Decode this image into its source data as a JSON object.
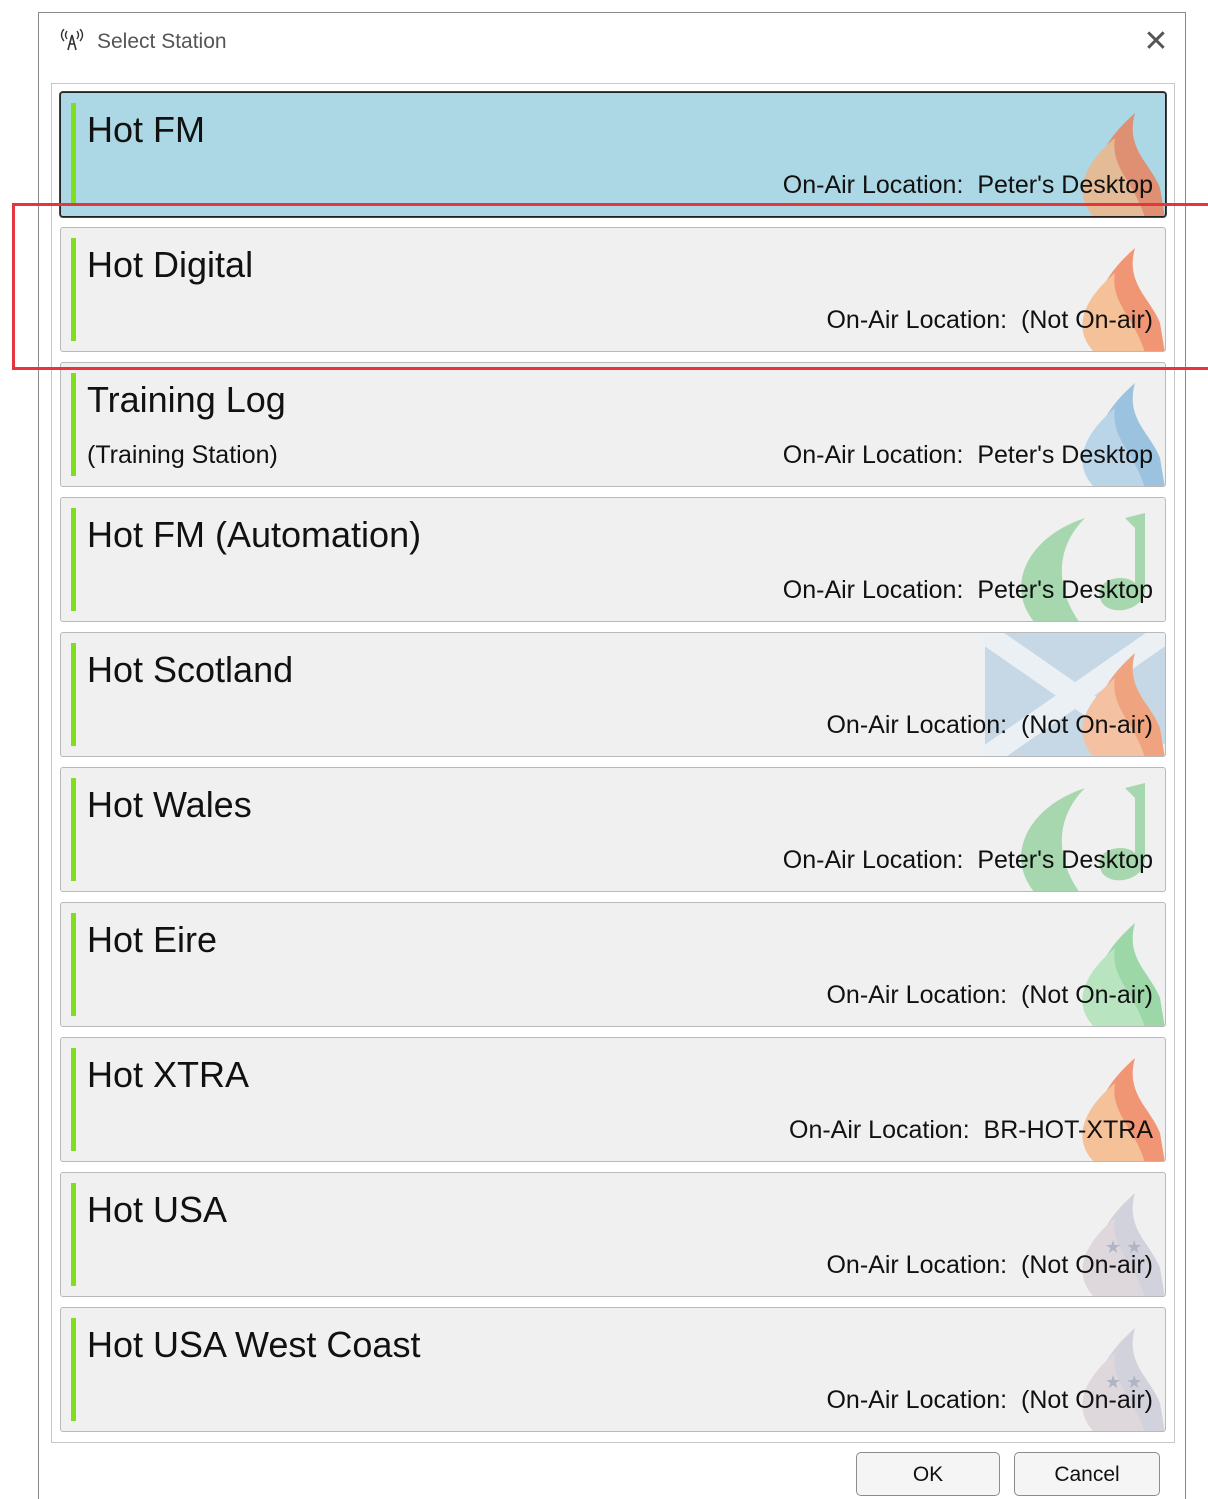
{
  "window": {
    "title": "Select Station",
    "icon": "antenna-icon",
    "close_symbol": "✕"
  },
  "stations": [
    {
      "name": "Hot FM",
      "sub": "",
      "location_label": "On-Air Location:",
      "location_value": "Peter's Desktop",
      "selected": true,
      "logo": "flame-logo"
    },
    {
      "name": "Hot Digital",
      "sub": "",
      "location_label": "On-Air Location:",
      "location_value": "(Not On-air)",
      "selected": false,
      "logo": "flame-logo"
    },
    {
      "name": "Training Log",
      "sub": "(Training Station)",
      "location_label": "On-Air Location:",
      "location_value": "Peter's Desktop",
      "selected": false,
      "logo": "flame-logo-blue"
    },
    {
      "name": "Hot FM (Automation)",
      "sub": "",
      "location_label": "On-Air Location:",
      "location_value": "Peter's Desktop",
      "selected": false,
      "logo": "swoosh-logo-green"
    },
    {
      "name": "Hot Scotland",
      "sub": "",
      "location_label": "On-Air Location:",
      "location_value": "(Not On-air)",
      "selected": false,
      "logo": "saltire-flame-logo"
    },
    {
      "name": "Hot Wales",
      "sub": "",
      "location_label": "On-Air Location:",
      "location_value": "Peter's Desktop",
      "selected": false,
      "logo": "swoosh-logo-green"
    },
    {
      "name": "Hot Eire",
      "sub": "",
      "location_label": "On-Air Location:",
      "location_value": "(Not On-air)",
      "selected": false,
      "logo": "flame-logo-green"
    },
    {
      "name": "Hot XTRA",
      "sub": "",
      "location_label": "On-Air Location:",
      "location_value": "BR-HOT-XTRA",
      "selected": false,
      "logo": "flame-logo"
    },
    {
      "name": "Hot USA",
      "sub": "",
      "location_label": "On-Air Location:",
      "location_value": "(Not On-air)",
      "selected": false,
      "logo": "stars-flame-logo"
    },
    {
      "name": "Hot USA West Coast",
      "sub": "",
      "location_label": "On-Air Location:",
      "location_value": "(Not On-air)",
      "selected": false,
      "logo": "stars-flame-logo"
    }
  ],
  "buttons": {
    "ok_label": "OK",
    "cancel_label": "Cancel"
  },
  "colors": {
    "selected_bg": "#acd7e5",
    "accent_bar": "#7ee01c",
    "highlight_box": "#e8343c"
  }
}
